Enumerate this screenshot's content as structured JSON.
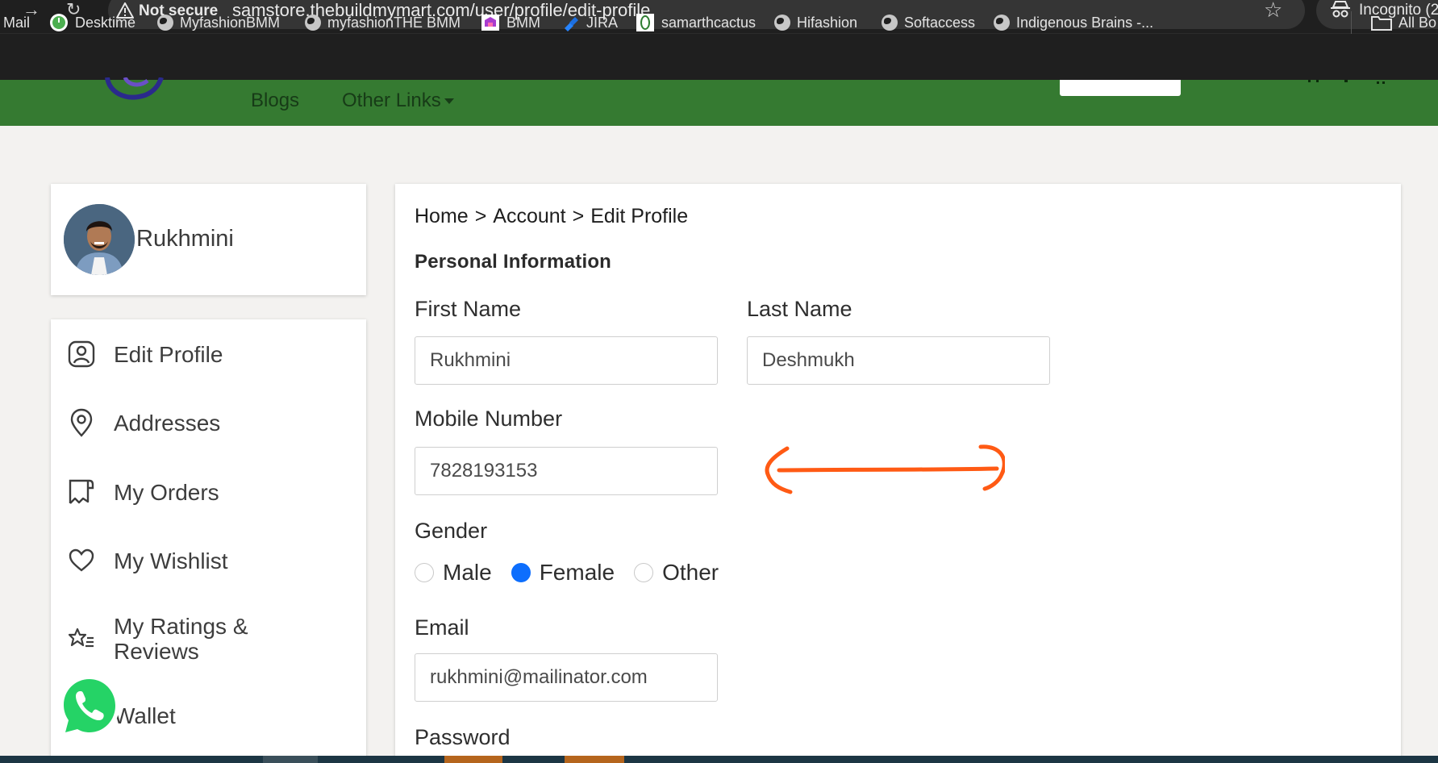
{
  "browser": {
    "security_label": "Not secure",
    "url": "samstore.thebuildmymart.com/user/profile/edit-profile",
    "incognito_label": "Incognito (2",
    "bookmarks": [
      {
        "label": "Mail",
        "icon": "none"
      },
      {
        "label": "Desktime",
        "icon": "desktime-icon"
      },
      {
        "label": "MyfashionBMM",
        "icon": "globe-icon"
      },
      {
        "label": "myfashionTHE BMM",
        "icon": "globe-icon"
      },
      {
        "label": "BMM",
        "icon": "bmm-icon"
      },
      {
        "label": "JIRA",
        "icon": "jira-icon"
      },
      {
        "label": "samarthcactus",
        "icon": "cactus-icon"
      },
      {
        "label": "Hifashion",
        "icon": "globe-icon"
      },
      {
        "label": "Softaccess",
        "icon": "globe-icon"
      },
      {
        "label": "Indigenous Brains -...",
        "icon": "globe-icon"
      }
    ],
    "all_bookmarks_label": "All Bo"
  },
  "header": {
    "nav": [
      {
        "label": "Blogs"
      },
      {
        "label": "Other Links"
      }
    ],
    "brand_color": "#357a31"
  },
  "profile": {
    "name": "Rukhmini"
  },
  "sidebar": {
    "items": [
      {
        "label": "Edit Profile",
        "icon": "user-icon"
      },
      {
        "label": "Addresses",
        "icon": "location-pin-icon"
      },
      {
        "label": "My Orders",
        "icon": "receipt-icon"
      },
      {
        "label": "My Wishlist",
        "icon": "heart-icon"
      },
      {
        "label": "My Ratings &",
        "label2": "Reviews",
        "icon": "star-list-icon"
      },
      {
        "label": "Wallet",
        "icon": "wallet-icon"
      }
    ]
  },
  "main": {
    "breadcrumb": [
      "Home",
      "Account",
      "Edit Profile"
    ],
    "breadcrumb_separator": ">",
    "section_title": "Personal Information",
    "fields": {
      "first_name": {
        "label": "First Name",
        "value": "Rukhmini"
      },
      "last_name": {
        "label": "Last Name",
        "value": "Deshmukh"
      },
      "mobile": {
        "label": "Mobile Number",
        "value": "7828193153"
      },
      "gender": {
        "label": "Gender",
        "options": [
          "Male",
          "Female",
          "Other"
        ],
        "selected": "Female"
      },
      "email": {
        "label": "Email",
        "value": "rukhmini@mailinator.com"
      },
      "password": {
        "label": "Password"
      }
    }
  },
  "colors": {
    "radio_selected": "#0d6efd",
    "annotation": "#ff5a14",
    "whatsapp": "#25d366"
  }
}
